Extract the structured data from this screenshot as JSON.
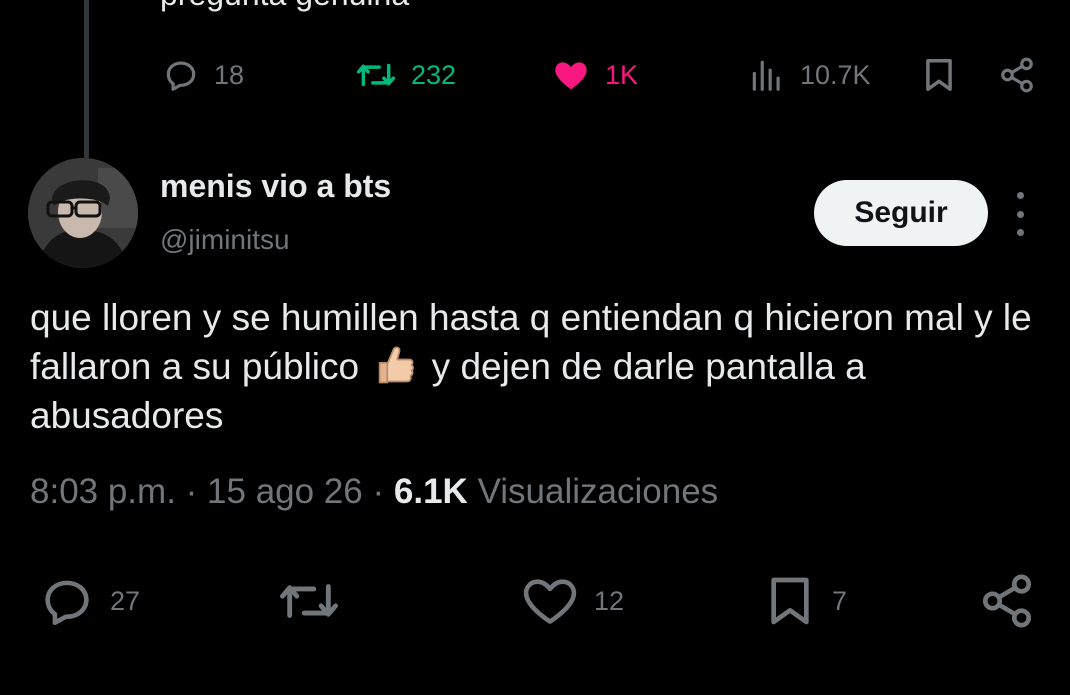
{
  "previous_tweet": {
    "text_fragment": "pregunta genuina",
    "actions": {
      "replies": "18",
      "retweets": "232",
      "likes": "1K",
      "views": "10.7K"
    },
    "colors": {
      "retweet": "#00ba7c",
      "like": "#f91880",
      "muted": "#71767b"
    }
  },
  "tweet": {
    "display_name": "menis vio a bts",
    "handle": "@jiminitsu",
    "follow_label": "Seguir",
    "text_part1": "que lloren y se humillen hasta q entiendan q hicieron mal y le fallaron a su público ",
    "emoji_icon": "thumbs-up-light-skin-icon",
    "text_part2": " y dejen de darle pantalla a abusadores",
    "time": "8:03 p.m.",
    "separator": "·",
    "date": "15 ago 26",
    "views_count": "6.1K",
    "views_label": "Visualizaciones",
    "actions": {
      "replies": "27",
      "likes": "12",
      "bookmarks": "7"
    }
  },
  "icons": {
    "reply": "reply-icon",
    "retweet": "retweet-icon",
    "like": "heart-icon",
    "views": "views-bar-chart-icon",
    "bookmark": "bookmark-icon",
    "share": "share-icon",
    "more": "more-vertical-icon"
  }
}
